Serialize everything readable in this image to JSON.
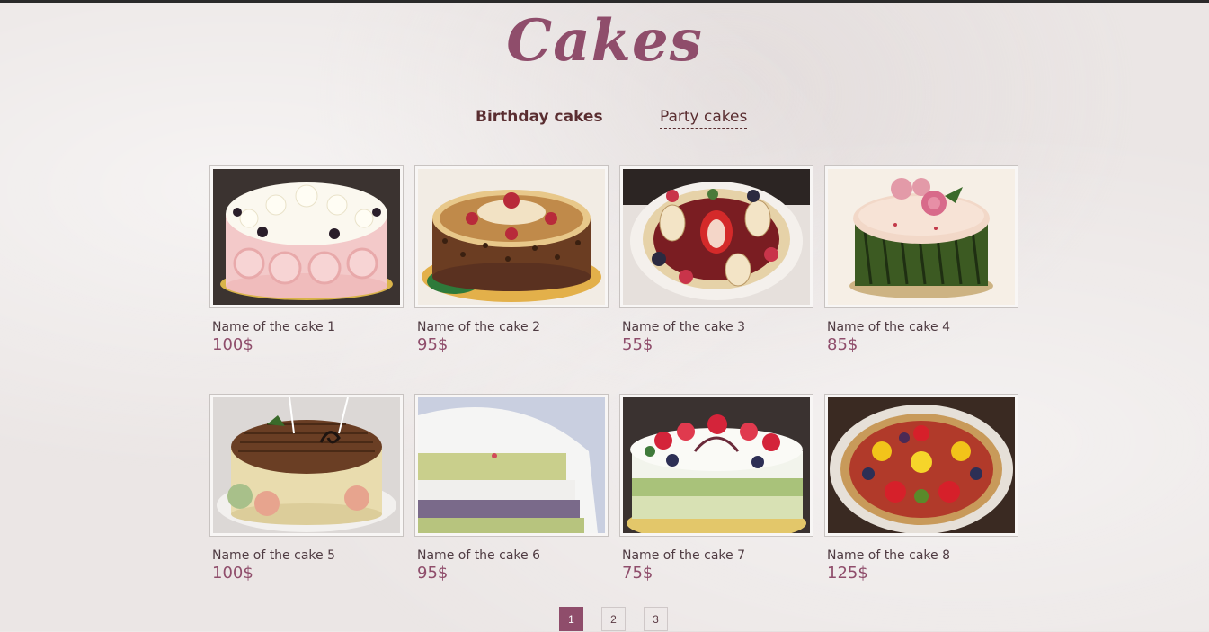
{
  "page": {
    "title": "Cakes"
  },
  "tabs": [
    {
      "label": "Birthday cakes",
      "active": true
    },
    {
      "label": "Party cakes",
      "active": false
    }
  ],
  "cakes": [
    {
      "name": "Name of the cake 1",
      "price": "100$"
    },
    {
      "name": "Name of the cake 2",
      "price": "95$"
    },
    {
      "name": "Name of the cake 3",
      "price": "55$"
    },
    {
      "name": "Name of the cake 4",
      "price": "85$"
    },
    {
      "name": "Name of the cake 5",
      "price": "100$"
    },
    {
      "name": "Name of the cake 6",
      "price": "95$"
    },
    {
      "name": "Name of the cake 7",
      "price": "75$"
    },
    {
      "name": "Name of the cake 8",
      "price": "125$"
    }
  ],
  "pagination": {
    "pages": [
      "1",
      "2",
      "3"
    ],
    "current": "1"
  },
  "colors": {
    "accent": "#8f4d6b",
    "background": "#ebe6e5",
    "tab_text": "#5a2e31"
  }
}
